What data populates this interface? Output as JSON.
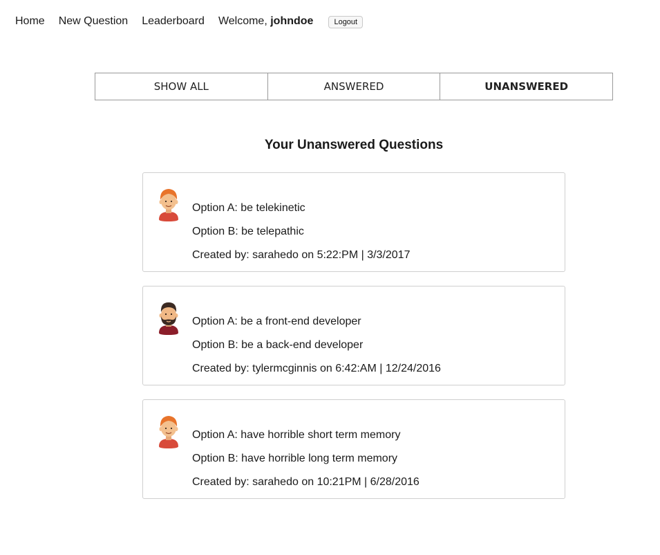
{
  "nav": {
    "home": "Home",
    "new_question": "New Question",
    "leaderboard": "Leaderboard",
    "welcome_prefix": "Welcome,",
    "username": "johndoe",
    "logout": "Logout"
  },
  "tabs": [
    {
      "label": "SHOW ALL",
      "active": false
    },
    {
      "label": "ANSWERED",
      "active": false
    },
    {
      "label": "UNANSWERED",
      "active": true
    }
  ],
  "section_title": "Your Unanswered Questions",
  "questions": [
    {
      "avatar": "red-haired-woman-avatar-icon",
      "option_a": "Option A: be telekinetic",
      "option_b": "Option B: be telepathic",
      "created": "Created by: sarahedo on 5:22:PM | 3/3/2017"
    },
    {
      "avatar": "bearded-man-avatar-icon",
      "option_a": "Option A: be a front-end developer",
      "option_b": "Option B: be a back-end developer",
      "created": "Created by: tylermcginnis on 6:42:AM | 12/24/2016"
    },
    {
      "avatar": "red-haired-woman-avatar-icon",
      "option_a": "Option A: have horrible short term memory",
      "option_b": "Option B: have horrible long term memory",
      "created": "Created by: sarahedo on 10:21PM | 6/28/2016"
    }
  ],
  "colors": {
    "border": "#cfcfcf",
    "tab_border": "#999999",
    "hair_red": "#e8742b",
    "shirt_red": "#d84a3a",
    "skin": "#f3c08e",
    "beard_dark": "#3b2a22",
    "shirt_maroon": "#8b1e2a"
  }
}
